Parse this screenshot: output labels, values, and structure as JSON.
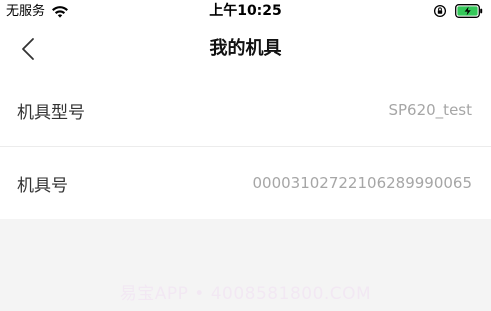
{
  "status_bar": {
    "carrier": "无服务",
    "time": "上午10:25",
    "icons": [
      "wifi-icon",
      "orientation-lock-icon",
      "battery-charging-icon"
    ],
    "battery_color": "#34c759"
  },
  "nav": {
    "back_icon": "chevron-left-icon",
    "title": "我的机具"
  },
  "list": {
    "rows": [
      {
        "label": "机具型号",
        "value": "SP620_test"
      },
      {
        "label": "机具号",
        "value": "00003102722106289990065"
      }
    ]
  },
  "watermark": "易宝APP • 4008581800.COM"
}
